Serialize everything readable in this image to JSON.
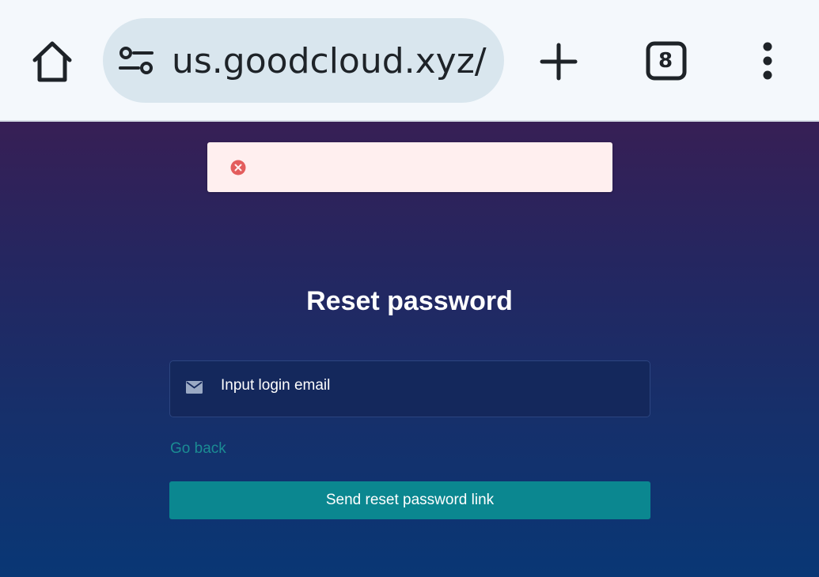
{
  "browser": {
    "url": "us.goodcloud.xyz/",
    "tab_count": "8"
  },
  "alert": {
    "message": ""
  },
  "reset": {
    "title": "Reset password",
    "email_placeholder": "Input login email",
    "email_value": "",
    "go_back_label": "Go back",
    "submit_label": "Send reset password link"
  },
  "icons": {
    "home": "home-icon",
    "site_settings": "tune-icon",
    "new_tab": "plus-icon",
    "tabs": "tab-switcher-icon",
    "menu": "more-vertical-icon",
    "alert": "error-icon",
    "email": "mail-icon"
  },
  "colors": {
    "browser_bar": "#f4f8fc",
    "url_pill": "#d9e6ee",
    "page_gradient_top": "#371f55",
    "page_gradient_bottom": "#093775",
    "alert_background": "#ffefef",
    "alert_icon": "#e35d5d",
    "link": "#1b8c93",
    "button": "#0b8790"
  }
}
